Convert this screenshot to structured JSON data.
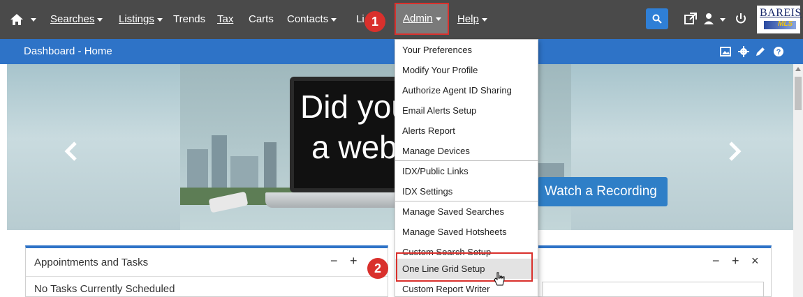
{
  "nav": {
    "home_icon": "home-icon",
    "items": [
      {
        "id": "searches",
        "label": "Searches",
        "has_caret": true
      },
      {
        "id": "listings",
        "label": "Listings",
        "has_caret": true
      },
      {
        "id": "trends",
        "label": "Trends",
        "has_caret": false
      },
      {
        "id": "tax",
        "label": "Tax",
        "has_caret": false
      },
      {
        "id": "carts",
        "label": "Carts",
        "has_caret": false
      },
      {
        "id": "contacts",
        "label": "Contacts",
        "has_caret": true
      },
      {
        "id": "links_partial",
        "label": "Li",
        "has_caret": false
      }
    ],
    "admin_label": "Admin",
    "help_label": "Help",
    "search_icon": "search-icon",
    "external_icon": "external-link-icon",
    "user_icon": "user-icon",
    "power_icon": "power-icon",
    "logo": {
      "name": "BAREIS",
      "sub": "MLS"
    }
  },
  "dashboard": {
    "title": "Dashboard - Home",
    "icons": [
      "image-icon",
      "gear-icon",
      "pencil-icon",
      "help-icon"
    ]
  },
  "banner": {
    "line1": "Did you",
    "line2": "a web",
    "cta": "Watch a Recording"
  },
  "widgets": {
    "left": {
      "title": "Appointments and Tasks",
      "body": "No Tasks Currently Scheduled",
      "minimize": "−",
      "move": "+"
    },
    "right": {
      "minimize": "−",
      "move": "+",
      "close": "×"
    }
  },
  "admin_menu": {
    "items": [
      "Your Preferences",
      "Modify Your Profile",
      "Authorize Agent ID Sharing",
      "Email Alerts Setup",
      "Alerts Report",
      "Manage Devices",
      "IDX/Public Links",
      "IDX Settings",
      "Manage Saved Searches",
      "Manage Saved Hotsheets",
      "Custom Search Setup",
      "One Line Grid Setup",
      "Custom Report Writer"
    ],
    "highlighted": "One Line Grid Setup"
  },
  "callouts": {
    "one": "1",
    "two": "2"
  },
  "colors": {
    "navbar": "#4a4a4a",
    "accent": "#2e73c7",
    "callout": "#d9302c",
    "button": "#2f7fc7"
  }
}
